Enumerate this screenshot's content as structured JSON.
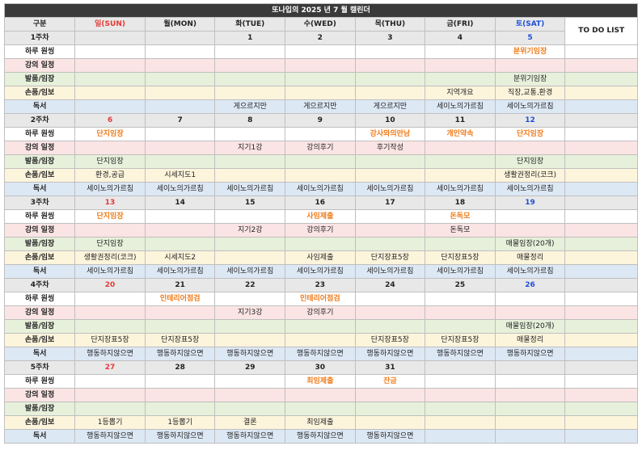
{
  "title": "또나입의 2025 년 7 월 캘린더",
  "header": {
    "corner": "구분",
    "days": [
      "일(SUN)",
      "월(MON)",
      "화(TUE)",
      "수(WED)",
      "목(THU)",
      "금(FRI)",
      "토(SAT)"
    ],
    "todo": "TO DO LIST"
  },
  "row_labels": [
    "하루 원씽",
    "강의 일정",
    "발품/임장",
    "손품/임보",
    "독서"
  ],
  "colors": {
    "sunday": "#e53935",
    "saturday": "#1e4fd8",
    "event": "#f07b1a",
    "title_bg": "#3a3a3a",
    "row_white": "#ffffff",
    "row_pink": "#fbe4e4",
    "row_green": "#e7f0da",
    "row_yellow": "#fdf4dc",
    "row_blue": "#dde8f5"
  },
  "weeks": [
    {
      "label": "1주차",
      "dates": [
        "",
        "",
        "1",
        "2",
        "3",
        "4",
        "5"
      ],
      "rows": [
        [
          "",
          "",
          "",
          "",
          "",
          "",
          "분위기임장"
        ],
        [
          "",
          "",
          "",
          "",
          "",
          "",
          ""
        ],
        [
          "",
          "",
          "",
          "",
          "",
          "",
          "분위기임장"
        ],
        [
          "",
          "",
          "",
          "",
          "",
          "지역개요",
          "직장,교통,환경"
        ],
        [
          "",
          "",
          "게으르지만",
          "게으르지만",
          "게으르지만",
          "세이노의가르침",
          "세이노의가르침"
        ]
      ]
    },
    {
      "label": "2주차",
      "dates": [
        "6",
        "7",
        "8",
        "9",
        "10",
        "11",
        "12"
      ],
      "rows": [
        [
          "단지임장",
          "",
          "",
          "",
          "강사와의만남",
          "개인약속",
          "단지임장"
        ],
        [
          "",
          "",
          "지기1강",
          "강의후기",
          "후기작성",
          "",
          ""
        ],
        [
          "단지임장",
          "",
          "",
          "",
          "",
          "",
          "단지임장"
        ],
        [
          "환경,공급",
          "시세지도1",
          "",
          "",
          "",
          "",
          "생활권정리(코크)"
        ],
        [
          "세이노의가르침",
          "세이노의가르침",
          "세이노의가르침",
          "세이노의가르침",
          "세이노의가르침",
          "세이노의가르침",
          "세이노의가르침"
        ]
      ]
    },
    {
      "label": "3주차",
      "dates": [
        "13",
        "14",
        "15",
        "16",
        "17",
        "18",
        "19"
      ],
      "rows": [
        [
          "단지임장",
          "",
          "",
          "사임제출",
          "",
          "돈독모",
          ""
        ],
        [
          "",
          "",
          "지기2강",
          "강의후기",
          "",
          "돈독모",
          ""
        ],
        [
          "단지임장",
          "",
          "",
          "",
          "",
          "",
          "매물임장(20개)"
        ],
        [
          "생활권정리(코크)",
          "시세지도2",
          "",
          "사임제출",
          "단지장표5장",
          "단지장표5장",
          "매물정리"
        ],
        [
          "세이노의가르침",
          "세이노의가르침",
          "세이노의가르침",
          "세이노의가르침",
          "세이노의가르침",
          "세이노의가르침",
          "세이노의가르침"
        ]
      ]
    },
    {
      "label": "4주차",
      "dates": [
        "20",
        "21",
        "22",
        "23",
        "24",
        "25",
        "26"
      ],
      "rows": [
        [
          "",
          "인테리어점검",
          "",
          "인테리어점검",
          "",
          "",
          ""
        ],
        [
          "",
          "",
          "지기3강",
          "강의후기",
          "",
          "",
          ""
        ],
        [
          "",
          "",
          "",
          "",
          "",
          "",
          "매물임장(20개)"
        ],
        [
          "단지장표5장",
          "단지장표5장",
          "",
          "",
          "단지장표5장",
          "단지장표5장",
          "매물정리"
        ],
        [
          "행동하지않으면",
          "행동하지않으면",
          "행동하지않으면",
          "행동하지않으면",
          "행동하지않으면",
          "행동하지않으면",
          "행동하지않으면"
        ]
      ]
    },
    {
      "label": "5주차",
      "dates": [
        "27",
        "28",
        "29",
        "30",
        "31",
        "",
        ""
      ],
      "rows": [
        [
          "",
          "",
          "",
          "최임제출",
          "잔금",
          "",
          ""
        ],
        [
          "",
          "",
          "",
          "",
          "",
          "",
          ""
        ],
        [
          "",
          "",
          "",
          "",
          "",
          "",
          ""
        ],
        [
          "1등뽑기",
          "1등뽑기",
          "결론",
          "최임제출",
          "",
          "",
          ""
        ],
        [
          "행동하지않으면",
          "행동하지않으면",
          "행동하지않으면",
          "행동하지않으면",
          "행동하지않으면",
          "",
          ""
        ]
      ]
    }
  ]
}
